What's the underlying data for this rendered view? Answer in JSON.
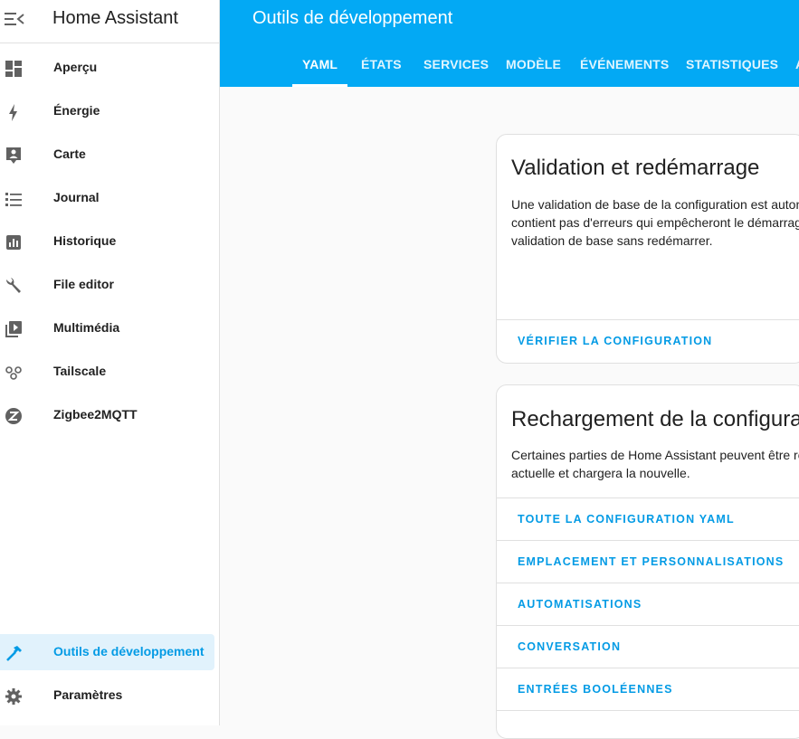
{
  "app": {
    "title": "Home Assistant"
  },
  "sidebar": {
    "items": [
      {
        "label": "Aperçu",
        "icon": "dashboard-icon"
      },
      {
        "label": "Énergie",
        "icon": "lightning-icon"
      },
      {
        "label": "Carte",
        "icon": "map-account-icon"
      },
      {
        "label": "Journal",
        "icon": "list-icon"
      },
      {
        "label": "Historique",
        "icon": "chart-box-icon"
      },
      {
        "label": "File editor",
        "icon": "wrench-icon"
      },
      {
        "label": "Multimédia",
        "icon": "play-box-multiple-icon"
      },
      {
        "label": "Tailscale",
        "icon": "tailscale-icon"
      },
      {
        "label": "Zigbee2MQTT",
        "icon": "zigbee-icon"
      }
    ],
    "dev_tools": "Outils de développement",
    "settings": "Paramètres",
    "active_color": "#039be5"
  },
  "header": {
    "title": "Outils de développement",
    "tabs": [
      "YAML",
      "ÉTATS",
      "SERVICES",
      "MODÈLE",
      "ÉVÉNEMENTS",
      "STATISTIQUES",
      "A"
    ],
    "active_tab": "YAML",
    "background": "#03a9f4"
  },
  "validation_card": {
    "title": "Validation et redémarrage",
    "text_lines": [
      "Une validation de base de la configuration est auton",
      "contient pas d'erreurs qui empêcheront le démarrag",
      "validation de base sans redémarrer."
    ],
    "button": "VÉRIFIER LA CONFIGURATION"
  },
  "reload_card": {
    "title": "Rechargement de la configurat",
    "text_lines": [
      "Certaines parties de Home Assistant peuvent être re",
      "actuelle et chargera la nouvelle."
    ],
    "items": [
      "TOUTE LA CONFIGURATION YAML",
      "EMPLACEMENT ET PERSONNALISATIONS",
      "AUTOMATISATIONS",
      "CONVERSATION",
      "ENTRÉES BOOLÉENNES"
    ]
  }
}
